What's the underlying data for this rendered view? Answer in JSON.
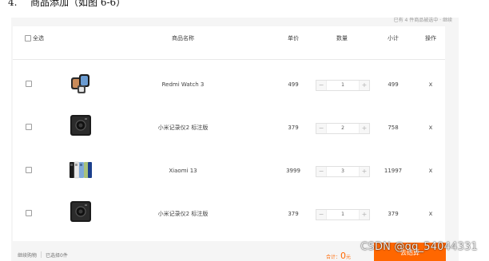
{
  "heading": {
    "number": "4.",
    "text": "商品添加（如图 6-6）"
  },
  "topbar": {
    "text": "已有 4 件商品被选中 · 继续"
  },
  "table": {
    "headers": {
      "select_all": "全选",
      "name": "商品名称",
      "price": "单价",
      "quantity": "数量",
      "subtotal": "小计",
      "action": "操作"
    },
    "rows": [
      {
        "name": "Redmi Watch 3",
        "price": "499",
        "quantity": "1",
        "subtotal": "499",
        "delete": "x",
        "image_icon": "smartwatch-image"
      },
      {
        "name": "小米记录仪2 标注版",
        "price": "379",
        "quantity": "2",
        "subtotal": "758",
        "delete": "x",
        "image_icon": "dashcam-image"
      },
      {
        "name": "Xiaomi 13",
        "price": "3999",
        "quantity": "3",
        "subtotal": "11997",
        "delete": "x",
        "image_icon": "phones-image"
      },
      {
        "name": "小米记录仪2 标注版",
        "price": "379",
        "quantity": "1",
        "subtotal": "379",
        "delete": "x",
        "image_icon": "dashcam-image"
      }
    ],
    "stepper": {
      "minus": "−",
      "plus": "+"
    }
  },
  "bottom": {
    "continue": "继续购物",
    "selected": "已选择0件",
    "total_label": "合计：",
    "total_value": "0",
    "total_unit": "元",
    "checkout": "去结算"
  },
  "watermark": "CSDN @qq_54044331",
  "colors": {
    "accent": "#ff6700",
    "border": "#e0e0e0",
    "panel_bg": "#f5f5f5"
  }
}
